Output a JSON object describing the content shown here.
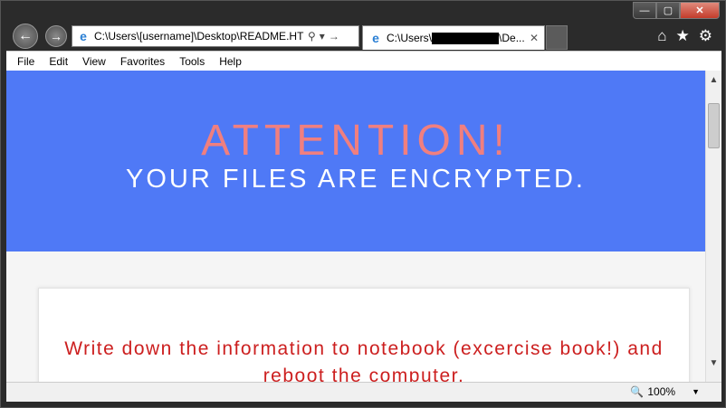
{
  "window": {
    "minimize_glyph": "—",
    "maximize_glyph": "▢",
    "close_glyph": "✕"
  },
  "nav": {
    "back_glyph": "←",
    "forward_glyph": "→",
    "address_value": "C:\\Users\\[username]\\Desktop\\README.HTML",
    "address_search_glyph": "⚲",
    "address_dropdown_glyph": "▾",
    "address_go_glyph": "→",
    "favicon_glyph": "e"
  },
  "tab": {
    "label_prefix": "C:\\Users\\",
    "label_suffix": "\\De...",
    "close_glyph": "✕"
  },
  "toolbar": {
    "home_glyph": "⌂",
    "favorites_glyph": "★",
    "tools_glyph": "⚙"
  },
  "menu": {
    "items": [
      "File",
      "Edit",
      "View",
      "Favorites",
      "Tools",
      "Help"
    ]
  },
  "page": {
    "title": "ATTENTION!",
    "subtitle": "YOUR FILES ARE ENCRYPTED.",
    "message": "Write down the information to notebook (excercise book!) and reboot the computer."
  },
  "scrollbar": {
    "up_glyph": "▲",
    "down_glyph": "▼"
  },
  "status": {
    "zoom_icon": "zoom-icon",
    "zoom_glyph": "🔍",
    "zoom_level": "100%",
    "zoom_dropdown_glyph": "▼"
  },
  "colors": {
    "hero_bg": "#4f79f6",
    "title": "#f07f7f",
    "message": "#cc1f1f"
  }
}
